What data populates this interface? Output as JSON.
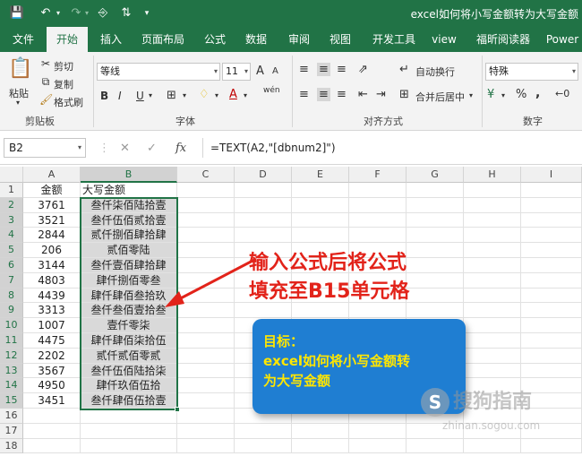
{
  "window": {
    "title": "excel如何将小写金额转为大写金额"
  },
  "ribbon_tabs": [
    "文件",
    "开始",
    "插入",
    "页面布局",
    "公式",
    "数据",
    "审阅",
    "视图",
    "开发工具",
    "view",
    "福昕阅读器",
    "Power"
  ],
  "ribbon": {
    "clipboard": {
      "paste": "粘贴",
      "cut": "剪切",
      "copy": "复制",
      "format_painter": "格式刷",
      "group": "剪贴板"
    },
    "font": {
      "name": "等线",
      "size": "11",
      "grow": "A",
      "shrink": "A",
      "bold": "B",
      "italic": "I",
      "underline": "U",
      "wen": "wén",
      "group": "字体"
    },
    "alignment": {
      "wrap_text": "自动换行",
      "merge_center": "合并后居中",
      "group": "对齐方式"
    },
    "number": {
      "format": "特殊",
      "percent": "%",
      "comma": ",",
      "group": "数字"
    }
  },
  "formula_bar": {
    "name_box": "B2",
    "fx": "fx",
    "formula": "=TEXT(A2,\"[dbnum2]\")"
  },
  "columns": [
    "A",
    "B",
    "C",
    "D",
    "E",
    "F",
    "G",
    "H",
    "I"
  ],
  "rows": [
    "1",
    "2",
    "3",
    "4",
    "5",
    "6",
    "7",
    "8",
    "9",
    "10",
    "11",
    "12",
    "13",
    "14",
    "15",
    "16",
    "17",
    "18"
  ],
  "header_row": {
    "a": "金额",
    "b": "大写金额"
  },
  "data_rows": [
    {
      "a": "3761",
      "b": "叁仟柒佰陆拾壹"
    },
    {
      "a": "3521",
      "b": "叁仟伍佰贰拾壹"
    },
    {
      "a": "2844",
      "b": "贰仟捌佰肆拾肆"
    },
    {
      "a": "206",
      "b": "贰佰零陆"
    },
    {
      "a": "3144",
      "b": "叁仟壹佰肆拾肆"
    },
    {
      "a": "4803",
      "b": "肆仟捌佰零叁"
    },
    {
      "a": "4439",
      "b": "肆仟肆佰叁拾玖"
    },
    {
      "a": "3313",
      "b": "叁仟叁佰壹拾叁"
    },
    {
      "a": "1007",
      "b": "壹仟零柒"
    },
    {
      "a": "4475",
      "b": "肆仟肆佰柒拾伍"
    },
    {
      "a": "2202",
      "b": "贰仟贰佰零贰"
    },
    {
      "a": "3567",
      "b": "叁仟伍佰陆拾柒"
    },
    {
      "a": "4950",
      "b": "肆仟玖佰伍拾"
    },
    {
      "a": "3451",
      "b": "叁仟肆佰伍拾壹"
    }
  ],
  "annotation": {
    "line1": "输入公式后将公式",
    "line2": "填充至B15单元格"
  },
  "goal": {
    "label": "目标：",
    "line1": "excel如何将小写金额转",
    "line2": "为大写金额"
  },
  "watermark": {
    "text": "搜狗指南",
    "url": "zhinan.sogou.com"
  },
  "colors": {
    "excel_green": "#217346",
    "annotation_red": "#e2231a",
    "goal_blue": "#1f7ed2",
    "goal_text": "#ffe600"
  }
}
